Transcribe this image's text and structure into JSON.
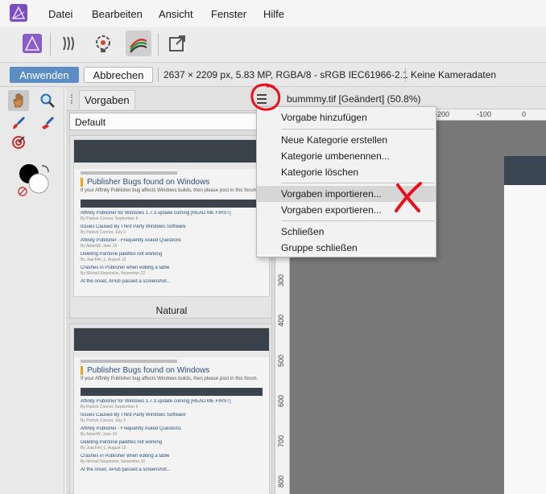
{
  "menubar": {
    "items": [
      "Datei",
      "Bearbeiten",
      "Ansicht",
      "Fenster",
      "Hilfe"
    ]
  },
  "toolbar": {
    "icons": [
      "persona-photo-icon",
      "liquify-persona-icon",
      "develop-persona-icon",
      "tone-mapping-persona-icon",
      "export-persona-icon"
    ]
  },
  "contextbar": {
    "apply_label": "Anwenden",
    "cancel_label": "Abbrechen",
    "image_info": "2637 × 2209 px, 5.83 MP, RGBA/8 - sRGB IEC61966-2.1",
    "camera_info": "Keine Kameradaten"
  },
  "panel": {
    "tab_label": "Vorgaben",
    "category": "Default",
    "presets": [
      {
        "label": "Natural",
        "thumb_title": "Publisher Bugs found on Windows",
        "thumb_sub": "If your Affinity Publisher bug affects Windows builds, then please post in this forum.",
        "rows": [
          {
            "title": "Affinity Publisher for Windows 1.7.3 update coming [READ ME FIRST]",
            "sub": "By Patrick Connor, September 6"
          },
          {
            "title": "Issues Caused By Third Party Windows Software",
            "sub": "By Patrick Connor, July 3"
          },
          {
            "title": "Affinity Publisher - Frequently Asked Questions",
            "sub": "By AdamW, June 19"
          },
          {
            "title": "Deleting Pantone palettes not working",
            "sub": "By Joachim_L, August 13"
          },
          {
            "title": "Crashes in Publisher when editing a table",
            "sub": "By Michail Stepnishin, November 22"
          },
          {
            "title": "At the onset, APub passed a screenshot...",
            "sub": ""
          }
        ]
      },
      {
        "label": "",
        "thumb_title": "Publisher Bugs found on Windows",
        "thumb_sub": "If your Affinity Publisher bug affects Windows builds, then please post in this forum.",
        "rows": [
          {
            "title": "Affinity Publisher for Windows 1.7.3 update coming [READ ME FIRST]",
            "sub": "By Patrick Connor, September 6"
          },
          {
            "title": "Issues Caused By Third Party Windows Software",
            "sub": "By Patrick Connor, July 3"
          },
          {
            "title": "Affinity Publisher - Frequently Asked Questions",
            "sub": "By AdamW, June 19"
          },
          {
            "title": "Deleting Pantone palettes not working",
            "sub": "By Joachim_L, August 13"
          },
          {
            "title": "Crashes in Publisher when editing a table",
            "sub": "By Michail Stepnishin, November 22"
          },
          {
            "title": "At the onset, APub passed a screenshot...",
            "sub": ""
          }
        ]
      }
    ]
  },
  "document": {
    "title": "bummmy.tif [Geändert] (50.8%)",
    "ruler_h": [
      "-200",
      "-100",
      "0"
    ],
    "ruler_v": [
      "300",
      "400",
      "500",
      "600",
      "700",
      "800"
    ]
  },
  "dropdown": {
    "items": [
      "Vorgabe hinzufügen",
      "Neue Kategorie erstellen",
      "Kategorie umbenennen...",
      "Kategorie löschen",
      "Vorgaben importieren...",
      "Vorgaben exportieren...",
      "Schließen",
      "Gruppe schließen"
    ],
    "highlighted_index": 4
  },
  "colors": {
    "accent": "#5b8cc4",
    "annotation": "#e8101a",
    "canvas": "#787878"
  }
}
